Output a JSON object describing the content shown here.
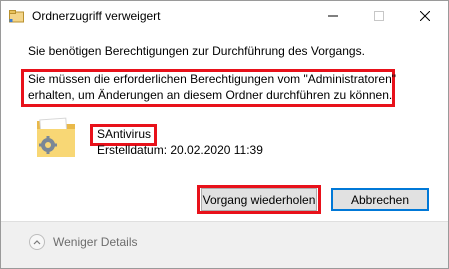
{
  "window": {
    "title": "Ordnerzugriff verweigert",
    "icon": "folder-access-icon"
  },
  "titlebar_buttons": {
    "minimize_icon": "minimize-icon",
    "maximize_icon": "maximize-icon",
    "close_icon": "close-icon"
  },
  "message": {
    "line1": "Sie benötigen Berechtigungen zur Durchführung des Vorgangs.",
    "warning_line1": "Sie müssen die erforderlichen Berechtigungen vom \"Administratoren\"",
    "warning_line2": "erhalten, um Änderungen an diesem Ordner durchführen zu können."
  },
  "folder": {
    "name": "SAntivirus",
    "created": "Erstelldatum: 20.02.2020 11:39",
    "icon": "folder-icon"
  },
  "buttons": {
    "retry": "Vorgang wiederholen",
    "cancel": "Abbrechen"
  },
  "footer": {
    "details_label": "Weniger Details",
    "details_icon": "chevron-up-icon"
  },
  "colors": {
    "highlight": "#e8111a",
    "focus": "#0078d7",
    "footer_bg": "#f0f0f0"
  }
}
